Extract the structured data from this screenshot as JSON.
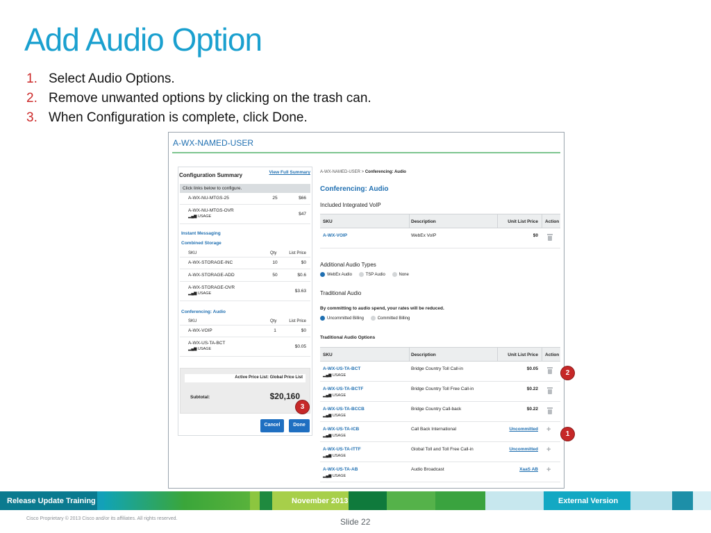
{
  "slide": {
    "title": "Add Audio Option",
    "steps": [
      {
        "num": "1.",
        "text": "Select Audio Options."
      },
      {
        "num": "2.",
        "text": "Remove unwanted options by clicking on the trash can."
      },
      {
        "num": "3.",
        "text": "When Configuration is complete, click Done."
      }
    ]
  },
  "screenshot": {
    "header_title": "A-WX-NAMED-USER",
    "summary": {
      "title": "Configuration Summary",
      "view_link": "View Full Summary",
      "instruction": "Click links below to configure.",
      "top_rows": [
        {
          "sku": "A-WX-NU-MTGS-25",
          "qty": "25",
          "price": "$66"
        },
        {
          "sku": "A-WX-NU-MTGS-OVR",
          "usage": "USAGE",
          "price": "$47"
        }
      ],
      "instant_messaging": "Instant Messaging",
      "combined_storage": "Combined Storage",
      "storage_headers": {
        "sku": "SKU",
        "qty": "Qty",
        "price": "List Price"
      },
      "storage_rows": [
        {
          "sku": "A-WX-STORAGE-INC",
          "qty": "10",
          "price": "$0"
        },
        {
          "sku": "A-WX-STORAGE-ADD",
          "qty": "50",
          "price": "$0.6"
        },
        {
          "sku": "A-WX-STORAGE-OVR",
          "usage": "USAGE",
          "price": "$3.63"
        }
      ],
      "conferencing_audio": "Conferencing: Audio",
      "audio_headers": {
        "sku": "SKU",
        "qty": "Qty",
        "price": "List Price"
      },
      "audio_rows": [
        {
          "sku": "A-WX-VOIP",
          "qty": "1",
          "price": "$0"
        },
        {
          "sku": "A-WX-US-TA-BCT",
          "usage": "USAGE",
          "price": "$0.05"
        }
      ],
      "active_price_list": "Active Price List: Global Price List",
      "subtotal_label": "Subtotal:",
      "subtotal_value": "$20,160",
      "cancel_label": "Cancel",
      "done_label": "Done"
    },
    "detail": {
      "breadcrumb_parent": "A-WX-NAMED-USER",
      "breadcrumb_sep": " > ",
      "breadcrumb_current": "Conferencing: Audio",
      "title": "Conferencing: Audio",
      "included_title": "Included Integrated VoIP",
      "headers": {
        "sku": "SKU",
        "description": "Description",
        "unit_price": "Unit List Price",
        "action": "Action"
      },
      "voip_row": {
        "sku": "A-WX-VOIP",
        "description": "WebEx VoIP",
        "price": "$0"
      },
      "additional_title": "Additional Audio Types",
      "additional_options": [
        "WebEx Audio",
        "TSP Audio",
        "None"
      ],
      "traditional_title": "Traditional Audio",
      "commit_note": "By committing to audio spend, your rates will be reduced.",
      "billing_options": [
        "Uncommitted Billing",
        "Committed Billing"
      ],
      "options_title": "Traditional Audio Options",
      "options_rows": [
        {
          "sku": "A-WX-US-TA-BCT",
          "usage": "USAGE",
          "description": "Bridge Country Toll Call-in",
          "price": "$0.05",
          "action": "trash"
        },
        {
          "sku": "A-WX-US-TA-BCTF",
          "usage": "USAGE",
          "description": "Bridge Country Toll Free Call-in",
          "price": "$0.22",
          "action": "trash"
        },
        {
          "sku": "A-WX-US-TA-BCCB",
          "usage": "USAGE",
          "description": "Bridge Country Call-back",
          "price": "$0.22",
          "action": "trash"
        },
        {
          "sku": "A-WX-US-TA-ICB",
          "usage": "USAGE",
          "description": "Call Back International",
          "price": "Uncommitted",
          "action": "plus"
        },
        {
          "sku": "A-WX-US-TA-ITTF",
          "usage": "USAGE",
          "description": "Global Toll and Toll Free Call-in",
          "price": "Uncommitted",
          "action": "plus"
        },
        {
          "sku": "A-WX-US-TA-AB",
          "usage": "USAGE",
          "description": "Audio Broadcast",
          "price": "XaaS AB",
          "action": "plus"
        }
      ]
    },
    "callouts": [
      "1",
      "2",
      "3"
    ]
  },
  "footer": {
    "left": "Release Update Training",
    "center": "November 2013",
    "right": "External Version",
    "copyright": "Cisco Proprietary © 2013 Cisco and/or its affiliates. All rights reserved.",
    "slide_label": "Slide 22"
  },
  "colors": {
    "title": "#1aa0cf",
    "step_number": "#cc2929",
    "link": "#1f6fb1",
    "button": "#1f6fc1",
    "callout": "#c62828"
  }
}
